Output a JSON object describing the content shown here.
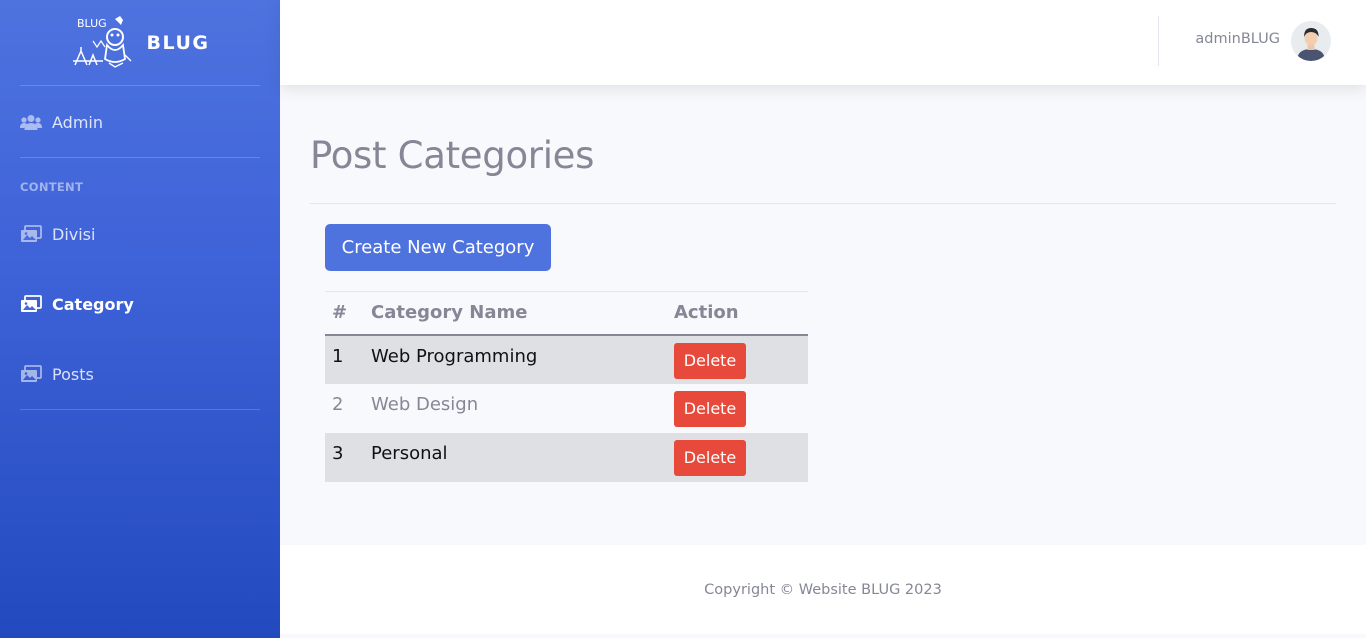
{
  "brand": {
    "name": "BLUG",
    "logo_text": "BLUG"
  },
  "sidebar": {
    "items": [
      {
        "label": "Admin",
        "icon": "users-icon"
      },
      {
        "label": "Divisi",
        "icon": "images-icon"
      },
      {
        "label": "Category",
        "icon": "images-icon",
        "active": true
      },
      {
        "label": "Posts",
        "icon": "images-icon"
      }
    ],
    "section_heading": "CONTENT"
  },
  "topbar": {
    "user_name": "adminBLUG"
  },
  "main": {
    "title": "Post Categories",
    "create_button": "Create New Category",
    "table": {
      "headers": [
        "#",
        "Category Name",
        "Action"
      ],
      "rows": [
        {
          "num": "1",
          "name": "Web Programming",
          "action": "Delete"
        },
        {
          "num": "2",
          "name": "Web Design",
          "action": "Delete"
        },
        {
          "num": "3",
          "name": "Personal",
          "action": "Delete"
        }
      ]
    }
  },
  "footer": {
    "text": "Copyright © Website BLUG 2023"
  },
  "colors": {
    "primary": "#4e73df",
    "danger": "#e74a3b",
    "muted": "#858796"
  }
}
